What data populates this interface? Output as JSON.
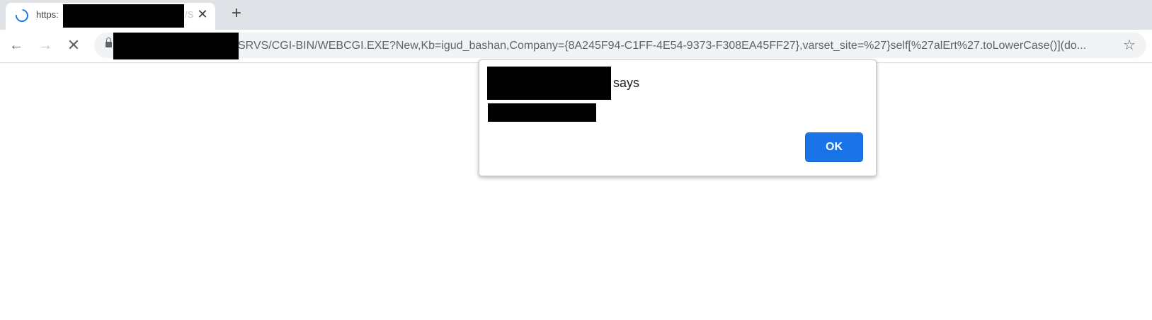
{
  "tab": {
    "title": "https:",
    "title_fade": "/S",
    "close_glyph": "✕",
    "spinner_icon": "loading-spinner-icon"
  },
  "new_tab": {
    "glyph": "+"
  },
  "nav": {
    "back_glyph": "←",
    "forward_glyph": "→",
    "stop_glyph": "✕"
  },
  "omnibox": {
    "url_visible": "SRVS/CGI-BIN/WEBCGI.EXE?New,Kb=igud_bashan,Company={8A245F94-C1FF-4E54-9373-F308EA45FF27},varset_site=%27}self[%27alErt%27.toLowerCase()](do...",
    "star_glyph": "☆"
  },
  "dialog": {
    "says_label": "says",
    "ok_label": "OK"
  },
  "colors": {
    "tabstrip": "#dee1e6",
    "accent": "#1a73e8",
    "omnibox_bg": "#f1f3f4"
  }
}
